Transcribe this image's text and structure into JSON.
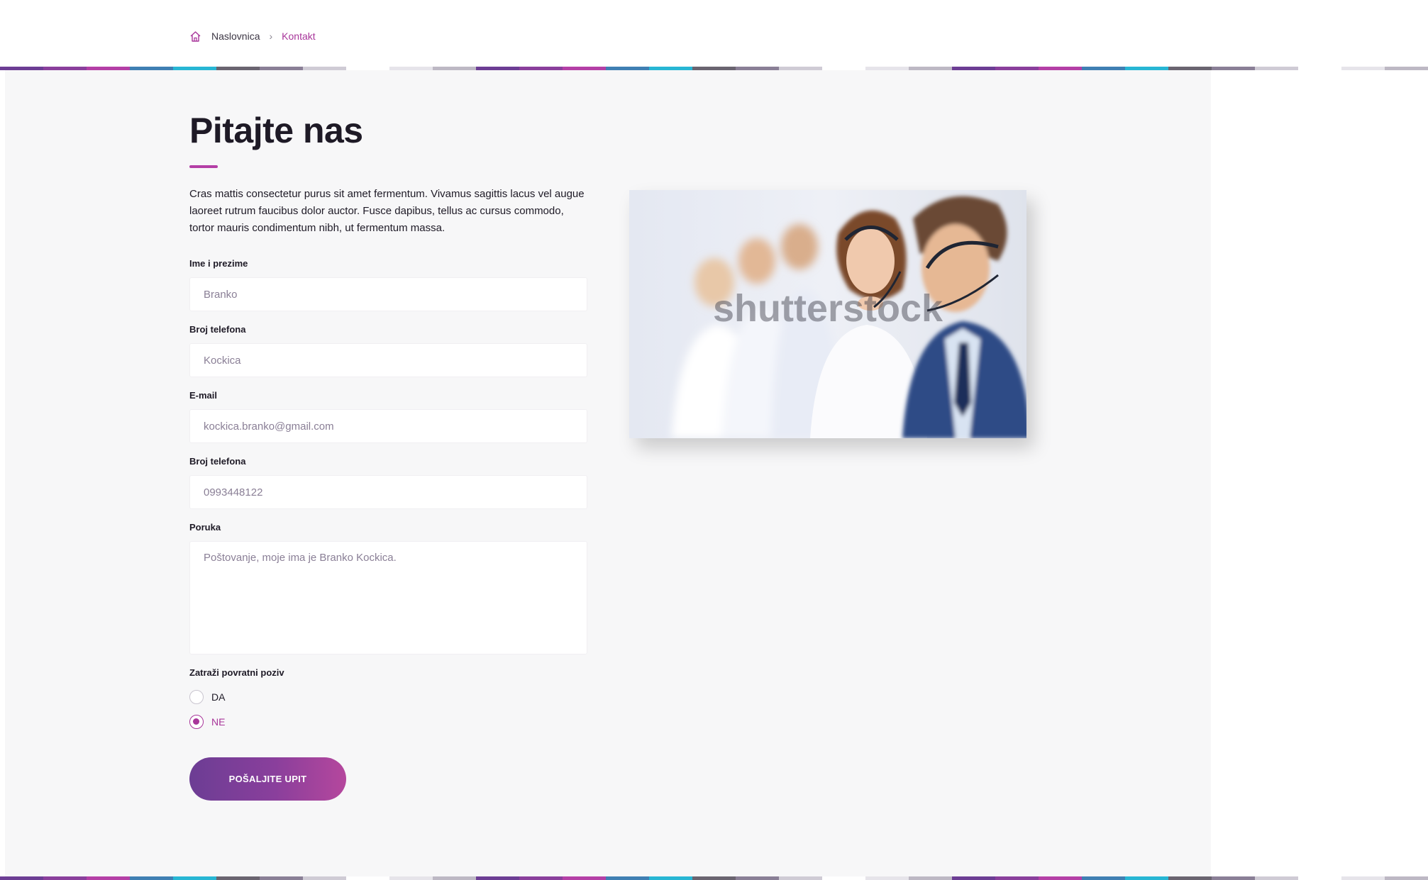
{
  "breadcrumb": {
    "home_icon": "home-icon",
    "items": [
      "Naslovnica",
      "Kontakt"
    ],
    "separator": "›"
  },
  "page": {
    "title": "Pitajte nas",
    "intro": "Cras mattis consectetur purus sit amet fermentum. Vivamus sagittis lacus vel augue laoreet rutrum faucibus dolor auctor. Fusce dapibus, tellus ac cursus commodo, tortor mauris condimentum nibh, ut fermentum massa."
  },
  "form": {
    "fields": [
      {
        "label": "Ime i prezime",
        "value": "Branko"
      },
      {
        "label": "Broj telefona",
        "value": "Kockica"
      },
      {
        "label": "E-mail",
        "value": "kockica.branko@gmail.com"
      },
      {
        "label": "Broj telefona",
        "value": "0993448122"
      }
    ],
    "message": {
      "label": "Poruka",
      "value": "Poštovanje, moje ima je Branko Kockica."
    },
    "callback": {
      "label": "Zatraži povratni poziv",
      "options": [
        {
          "label": "DA",
          "checked": false
        },
        {
          "label": "NE",
          "checked": true
        }
      ]
    },
    "submit_label": "POŠALJITE UPIT"
  },
  "image": {
    "watermark": "shutterstock"
  },
  "colors": {
    "accent": "#a8359a",
    "heading": "#1e1a26",
    "panel": "#f7f7f8",
    "button_start": "#6c3d94",
    "button_end": "#b5479d"
  }
}
